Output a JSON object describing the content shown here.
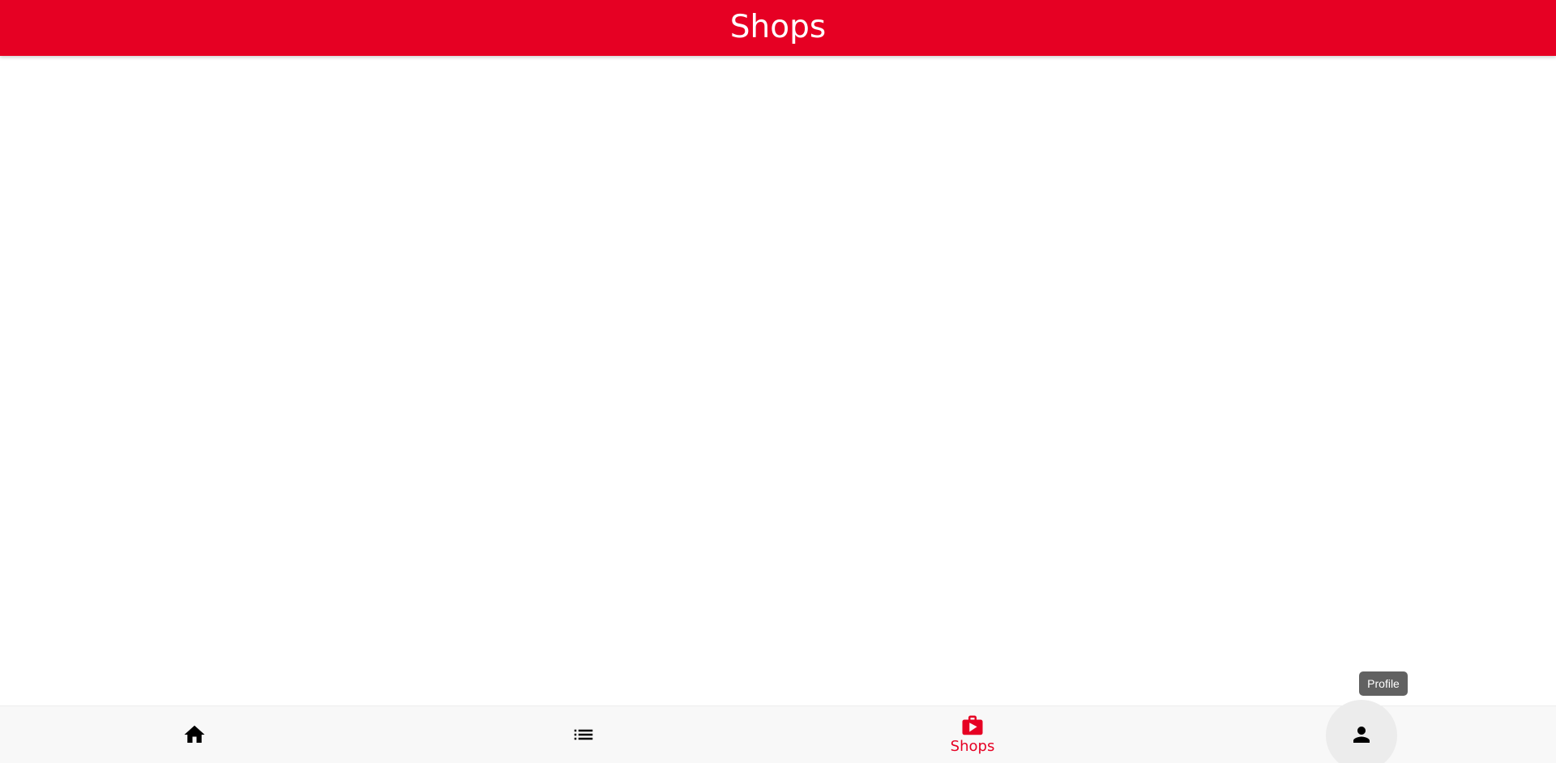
{
  "app_bar": {
    "title": "Shops",
    "background_color": "#e60023"
  },
  "bottom_nav": {
    "active_color": "#e60023",
    "items": [
      {
        "id": "home",
        "icon": "home-icon",
        "label": ""
      },
      {
        "id": "list",
        "icon": "list-icon",
        "label": ""
      },
      {
        "id": "shops",
        "icon": "shopping-bag-icon",
        "label": "Shops",
        "active": true
      },
      {
        "id": "profile",
        "icon": "person-icon",
        "label": ""
      }
    ]
  },
  "tooltip": {
    "text": "Profile"
  }
}
